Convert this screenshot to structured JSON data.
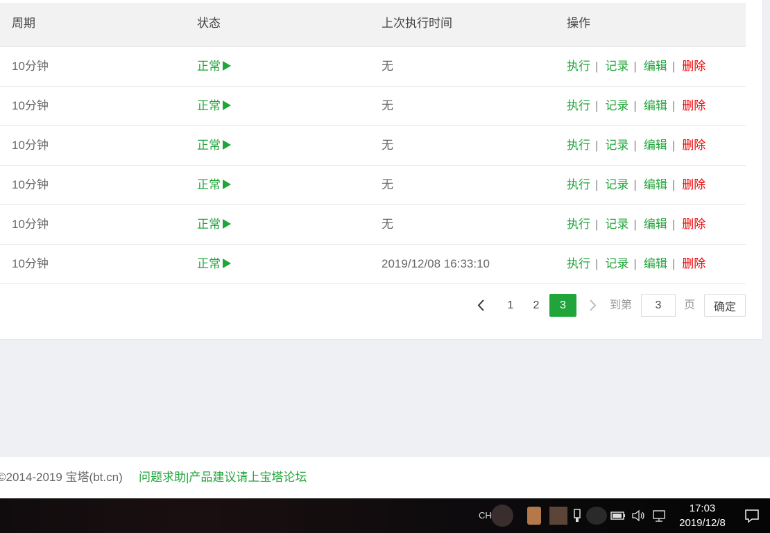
{
  "table": {
    "headers": [
      "周期",
      "状态",
      "上次执行时间",
      "操作"
    ],
    "rows": [
      {
        "period": "10分钟",
        "status": "正常",
        "last_run": "无"
      },
      {
        "period": "10分钟",
        "status": "正常",
        "last_run": "无"
      },
      {
        "period": "10分钟",
        "status": "正常",
        "last_run": "无"
      },
      {
        "period": "10分钟",
        "status": "正常",
        "last_run": "无"
      },
      {
        "period": "10分钟",
        "status": "正常",
        "last_run": "无"
      },
      {
        "period": "10分钟",
        "status": "正常",
        "last_run": "2019/12/08 16:33:10"
      }
    ],
    "actions": {
      "run": "执行",
      "log": "记录",
      "edit": "编辑",
      "delete": "删除",
      "separator": "|"
    }
  },
  "pagination": {
    "pages": [
      "1",
      "2"
    ],
    "current": "3",
    "goto_label": "到第",
    "page_input": "3",
    "page_suffix": "页",
    "confirm": "确定"
  },
  "footer": {
    "copyright": "©2014-2019 宝塔(bt.cn)",
    "forum_link": "问题求助|产品建议请上宝塔论坛"
  },
  "taskbar": {
    "ime": "CH",
    "time": "17:03",
    "date": "2019/12/8"
  },
  "colors": {
    "accent": "#20a53a",
    "danger": "#e00000"
  }
}
